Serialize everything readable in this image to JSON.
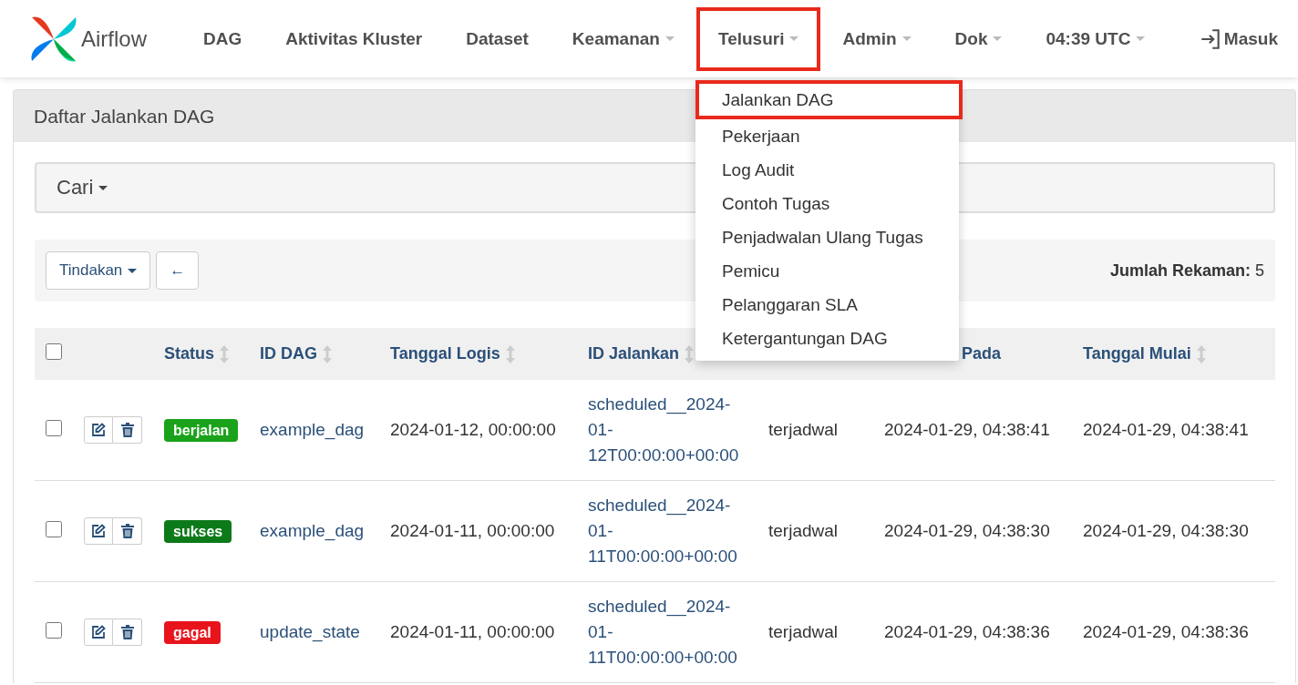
{
  "navbar": {
    "brand": "Airflow",
    "items": [
      {
        "label": "DAG",
        "dropdown": false,
        "highlighted": false
      },
      {
        "label": "Aktivitas Kluster",
        "dropdown": false,
        "highlighted": false
      },
      {
        "label": "Dataset",
        "dropdown": false,
        "highlighted": false
      },
      {
        "label": "Keamanan",
        "dropdown": true,
        "highlighted": false
      },
      {
        "label": "Telusuri",
        "dropdown": true,
        "highlighted": true
      },
      {
        "label": "Admin",
        "dropdown": true,
        "highlighted": false
      },
      {
        "label": "Dok",
        "dropdown": true,
        "highlighted": false
      },
      {
        "label": "04:39 UTC",
        "dropdown": true,
        "highlighted": false
      }
    ],
    "login": "Masuk"
  },
  "menu": {
    "items": [
      {
        "label": "Jalankan DAG",
        "highlighted": true
      },
      {
        "label": "Pekerjaan",
        "highlighted": false
      },
      {
        "label": "Log Audit",
        "highlighted": false
      },
      {
        "label": "Contoh Tugas",
        "highlighted": false
      },
      {
        "label": "Penjadwalan Ulang Tugas",
        "highlighted": false
      },
      {
        "label": "Pemicu",
        "highlighted": false
      },
      {
        "label": "Pelanggaran SLA",
        "highlighted": false
      },
      {
        "label": "Ketergantungan DAG",
        "highlighted": false
      }
    ]
  },
  "panel": {
    "title": "Daftar Jalankan DAG",
    "search": "Cari",
    "actions": "Tindakan",
    "back": "←",
    "record_label": "Jumlah Rekaman:",
    "record_count": "5"
  },
  "table": {
    "select_all": {
      "checked": false
    },
    "columns": [
      {
        "label": "Status",
        "covered": false
      },
      {
        "label": "ID DAG",
        "covered": false
      },
      {
        "label": "Tanggal Logis",
        "covered": false
      },
      {
        "label": "ID Jalankan",
        "covered": false
      },
      {
        "label": "Pada",
        "covered": true
      },
      {
        "label": "Tanggal Mulai",
        "covered": false
      }
    ],
    "rows": [
      {
        "checked": false,
        "status": {
          "label": "berjalan",
          "color": "#1aa31a"
        },
        "dag_id": "example_dag",
        "logical_date": "2024-01-12, 00:00:00",
        "run_id": "scheduled__2024-01-12T00:00:00+00:00",
        "run_type": "terjadwal",
        "end": "2024-01-29, 04:38:41",
        "start": "2024-01-29, 04:38:41"
      },
      {
        "checked": false,
        "status": {
          "label": "sukses",
          "color": "#0d7a1a"
        },
        "dag_id": "example_dag",
        "logical_date": "2024-01-11, 00:00:00",
        "run_id": "scheduled__2024-01-11T00:00:00+00:00",
        "run_type": "terjadwal",
        "end": "2024-01-29, 04:38:30",
        "start": "2024-01-29, 04:38:30"
      },
      {
        "checked": false,
        "status": {
          "label": "gagal",
          "color": "#e8141c"
        },
        "dag_id": "update_state",
        "logical_date": "2024-01-11, 00:00:00",
        "run_id": "scheduled__2024-01-11T00:00:00+00:00",
        "run_type": "terjadwal",
        "end": "2024-01-29, 04:38:36",
        "start": "2024-01-29, 04:38:36"
      }
    ]
  }
}
